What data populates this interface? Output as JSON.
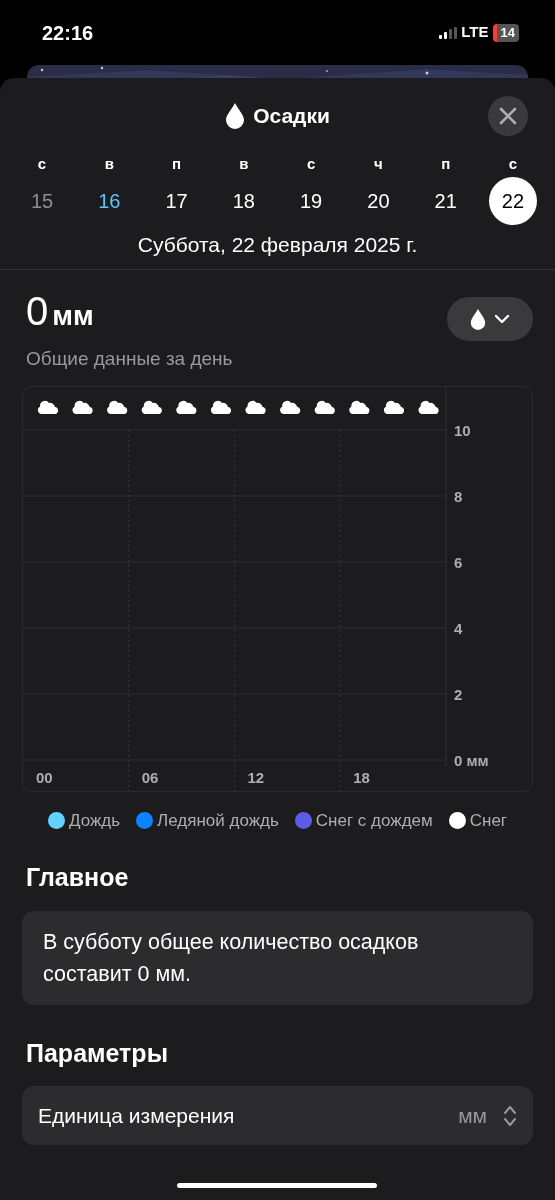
{
  "status_bar": {
    "time": "22:16",
    "network": "LTE",
    "battery": "14"
  },
  "sheet": {
    "title": "Осадки"
  },
  "days": [
    {
      "weekday": "с",
      "day": "15",
      "kind": "past",
      "selected": false
    },
    {
      "weekday": "в",
      "day": "16",
      "kind": "today",
      "selected": false
    },
    {
      "weekday": "п",
      "day": "17",
      "kind": "future",
      "selected": false
    },
    {
      "weekday": "в",
      "day": "18",
      "kind": "future",
      "selected": false
    },
    {
      "weekday": "с",
      "day": "19",
      "kind": "future",
      "selected": false
    },
    {
      "weekday": "ч",
      "day": "20",
      "kind": "future",
      "selected": false
    },
    {
      "weekday": "п",
      "day": "21",
      "kind": "future",
      "selected": false
    },
    {
      "weekday": "с",
      "day": "22",
      "kind": "future",
      "selected": true
    }
  ],
  "date_label": "Суббота, 22 февраля 2025 г.",
  "summary": {
    "value": "0",
    "unit": "мм",
    "caption": "Общие данные за день"
  },
  "chart": {
    "conditions": [
      {
        "kind": "cloud"
      },
      {
        "kind": "cloud"
      },
      {
        "kind": "cloud"
      },
      {
        "kind": "cloud"
      },
      {
        "kind": "cloud"
      },
      {
        "kind": "cloud"
      },
      {
        "kind": "cloud"
      },
      {
        "kind": "cloud"
      },
      {
        "kind": "cloud"
      },
      {
        "kind": "cloud"
      },
      {
        "kind": "cloud"
      },
      {
        "kind": "cloud"
      }
    ],
    "chart_data": {
      "type": "bar",
      "ylim": [
        0,
        11.3
      ],
      "grid": true,
      "categories": [
        "00",
        "06",
        "12",
        "18"
      ],
      "yticks": [
        {
          "value": 0,
          "label": "0 мм"
        },
        {
          "value": 2,
          "label": "2"
        },
        {
          "value": 4,
          "label": "4"
        },
        {
          "value": 6,
          "label": "6"
        },
        {
          "value": 8,
          "label": "8"
        },
        {
          "value": 10,
          "label": "10"
        }
      ]
    }
  },
  "legend": [
    {
      "label": "Дождь",
      "color": "#64d2ff"
    },
    {
      "label": "Ледяной дождь",
      "color": "#0a84ff"
    },
    {
      "label": "Снег с дождем",
      "color": "#5e5ce6"
    },
    {
      "label": "Снег",
      "color": "#ffffff"
    }
  ],
  "highlights": {
    "title": "Главное",
    "text": "В субботу общее количество осадков составит 0 мм."
  },
  "parameters": {
    "title": "Параметры",
    "rows": [
      {
        "label": "Единица измерения",
        "value": "мм"
      }
    ]
  }
}
